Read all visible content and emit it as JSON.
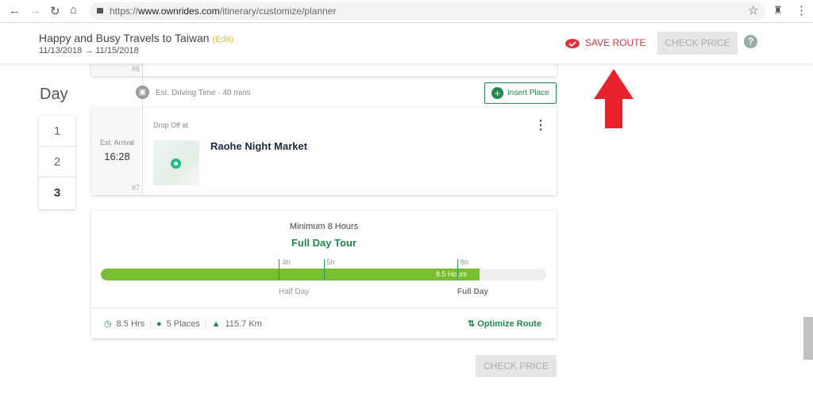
{
  "browser": {
    "url_prefix": "https://",
    "url_domain": "www.ownrides.com",
    "url_path": "/itinerary/customize/planner"
  },
  "header": {
    "title": "Happy and Busy Travels to Taiwan",
    "edit": "(Edit)",
    "start_date": "11/13/2018",
    "end_date": "11/15/2018",
    "save_route": "SAVE ROUTE",
    "check_price": "CHECK PRICE",
    "help": "?"
  },
  "day": {
    "label": "Day",
    "items": [
      "1",
      "2",
      "3"
    ],
    "selected": "3"
  },
  "prev_stop": {
    "index": "#6"
  },
  "drive": {
    "label": "Est. Driving Time",
    "sep": "·",
    "value": "40 mins",
    "insert": "Insert Place"
  },
  "stop": {
    "arrival_label": "Est. Arrival",
    "arrival": "16:28",
    "index": "#7",
    "type": "Drop Off at",
    "name": "Raohe Night Market"
  },
  "summary": {
    "minimum": "Minimum 8 Hours",
    "tour_type": "Full Day Tour",
    "progress_hours": 8.5,
    "scale_max_hours": 10,
    "progress_label": "8.5 Hours",
    "ticks": [
      {
        "label": "4h",
        "hours": 4
      },
      {
        "label": "5h",
        "hours": 5
      },
      {
        "label": "8h",
        "hours": 8
      }
    ],
    "half_day": "Half Day",
    "full_day": "Full Day",
    "hrs": "8.5 Hrs",
    "places": "5 Places",
    "distance": "115.7 Km",
    "optimize": "Optimize Route"
  },
  "footer": {
    "check_price": "CHECK PRICE"
  },
  "colors": {
    "green": "#1f8a4c",
    "bar": "#76bf2f",
    "red": "#e8232b"
  }
}
